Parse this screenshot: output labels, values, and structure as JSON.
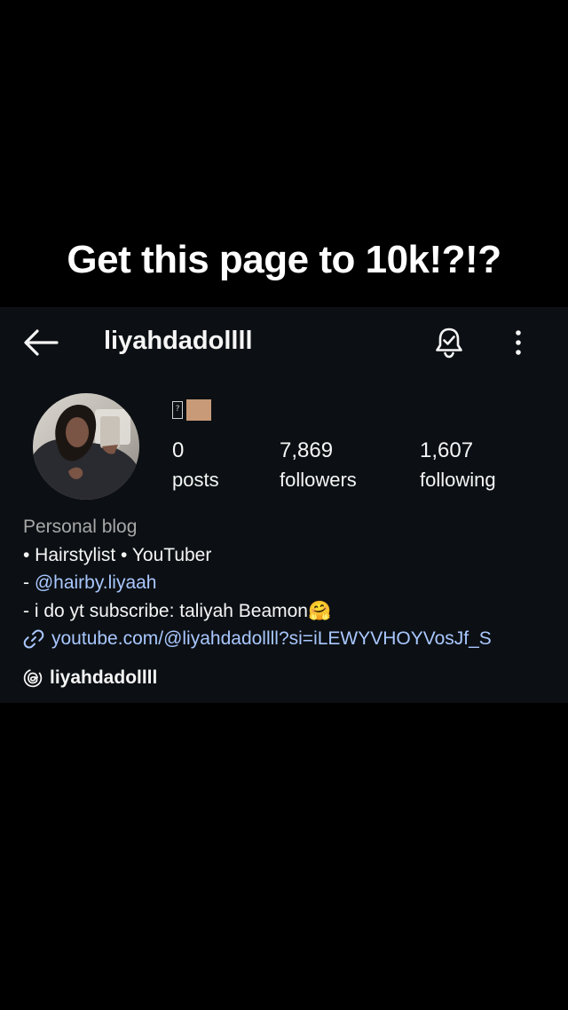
{
  "caption": "Get this page to 10k!?!?",
  "profile": {
    "username": "liyahdadollll",
    "note_emoji": "🏽",
    "stats": {
      "posts": {
        "count": "0",
        "label": "posts"
      },
      "followers": {
        "count": "7,869",
        "label": "followers"
      },
      "following": {
        "count": "1,607",
        "label": "following"
      }
    },
    "bio": {
      "category": "Personal blog",
      "line1": "• Hairstylist • YouTuber",
      "line2_prefix": "- ",
      "line2_mention": "@hairby.liyaah",
      "line3": "- i do yt subscribe: taliyah Beamon🤗",
      "link": "youtube.com/@liyahdadollll?si=iLEWYVHOYVosJf_S"
    },
    "threads_handle": "liyahdadollll"
  },
  "icons": {
    "back": "arrow-left-icon",
    "bell": "notification-bell-icon",
    "more": "more-vertical-icon",
    "link": "link-icon",
    "threads": "threads-icon"
  },
  "colors": {
    "card_bg": "#0c1014",
    "link": "#a9c7ff",
    "muted": "#a8a8a8"
  }
}
